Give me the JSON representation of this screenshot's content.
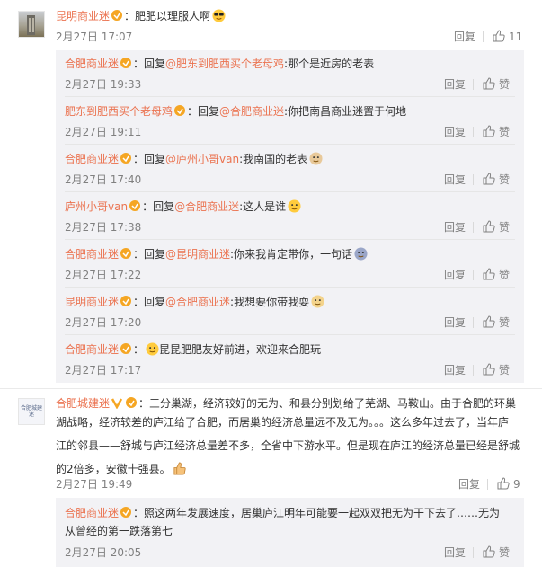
{
  "comments": [
    {
      "user": "昆明商业迷",
      "sep": "：",
      "text": "肥肥以理服人啊",
      "time": "2月27日 17:07",
      "reply_label": "回复",
      "likes": "11"
    },
    {
      "user": "合肥城建迷",
      "sep": "：",
      "text_lines": [
        "三分巢湖，经济较好的无为、和县分别划给了芜湖、马鞍山。由于合肥的环巢",
        "湖战略，经济较差的庐江给了合肥，而居巢的经济总量远不及无为。。。这么多年过去了，当年庐",
        "江的邻县——舒城与庐江经济总量差不多，全省中下游水平。但是现在庐江的经济总量已经是舒城",
        "的2倍多，安徽十强县。"
      ],
      "time": "2月27日 19:49",
      "reply_label": "回复",
      "likes": "9"
    }
  ],
  "replies1": [
    {
      "user": "合肥商业迷",
      "body_prefix": "：回复",
      "mention": "@肥东到肥西买个老母鸡",
      "body": ":那个是近房的老表",
      "time": "2月27日 19:33",
      "reply_label": "回复",
      "like_label": "赞"
    },
    {
      "user": "肥东到肥西买个老母鸡",
      "body_prefix": "：回复",
      "mention": "@合肥商业迷",
      "body": ":你把南昌商业迷置于何地",
      "time": "2月27日 19:11",
      "reply_label": "回复",
      "like_label": "赞"
    },
    {
      "user": "合肥商业迷",
      "body_prefix": "：回复",
      "mention": "@庐州小哥van",
      "body": ":我南国的老表",
      "time": "2月27日 17:40",
      "reply_label": "回复",
      "like_label": "赞"
    },
    {
      "user": "庐州小哥van",
      "body_prefix": "：回复",
      "mention": "@合肥商业迷",
      "body": ":这人是谁",
      "time": "2月27日 17:38",
      "reply_label": "回复",
      "like_label": "赞"
    },
    {
      "user": "合肥商业迷",
      "body_prefix": "：回复",
      "mention": "@昆明商业迷",
      "body": ":你来我肯定带你，一句话",
      "time": "2月27日 17:22",
      "reply_label": "回复",
      "like_label": "赞"
    },
    {
      "user": "昆明商业迷",
      "body_prefix": "：回复",
      "mention": "@合肥商业迷",
      "body": ":我想要你带我耍",
      "time": "2月27日 17:20",
      "reply_label": "回复",
      "like_label": "赞"
    },
    {
      "user": "合肥商业迷",
      "body_prefix": "：",
      "mention": "",
      "body": "昆昆肥肥友好前进，欢迎来合肥玩",
      "time": "2月27日 17:17",
      "reply_label": "回复",
      "like_label": "赞"
    }
  ],
  "replies2": [
    {
      "user": "合肥商业迷",
      "body_prefix": "：",
      "body_lines": [
        "照这两年发展速度，居巢庐江明年可能要一起双双把无为干下去了……无为",
        "从曾经的第一跌落第七"
      ],
      "time": "2月27日 20:05",
      "reply_label": "回复",
      "like_label": "赞"
    }
  ],
  "avatar2_text": "合肥城建迷",
  "colors": {
    "username": "#eb7350",
    "mention": "#eb7350",
    "meta": "#808080",
    "reply_bg": "#f2f2f5",
    "v_badge": "#f5a623"
  }
}
